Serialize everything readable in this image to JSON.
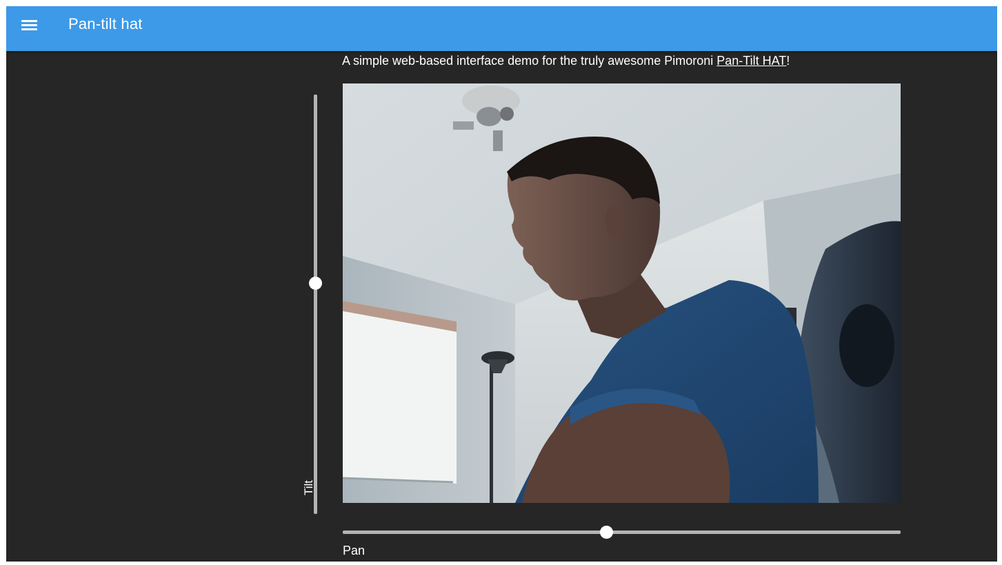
{
  "app": {
    "title": "Pan-tilt hat",
    "menu_icon": "hamburger-menu-icon",
    "header_color": "#3d9ae8",
    "background_color": "#262626"
  },
  "intro": {
    "text_before": "A simple web-based interface demo for the truly awesome Pimoroni ",
    "link_text": "Pan-Tilt HAT",
    "text_after": "!"
  },
  "camera": {
    "content": "live-camera-feed"
  },
  "tilt": {
    "label": "Tilt",
    "value_fraction": 0.45
  },
  "pan": {
    "label": "Pan",
    "value_fraction": 0.473
  }
}
